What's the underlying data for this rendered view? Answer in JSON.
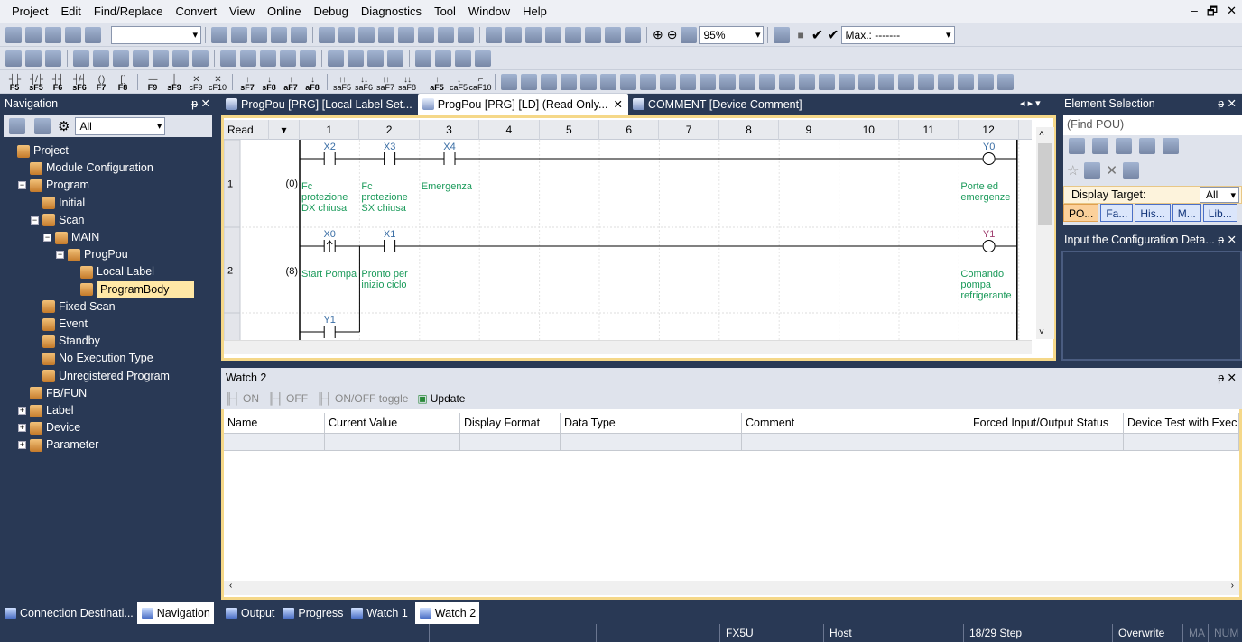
{
  "menu": [
    "Project",
    "Edit",
    "Find/Replace",
    "Convert",
    "View",
    "Online",
    "Debug",
    "Diagnostics",
    "Tool",
    "Window",
    "Help"
  ],
  "window_controls": [
    "–",
    "🗗",
    "✕"
  ],
  "toolbar": {
    "zoom": "95%",
    "max": "Max.: -------",
    "fkeys": [
      "F5",
      "sF5",
      "F6",
      "sF6",
      "F7",
      "F8",
      "F9",
      "sF9",
      "cF9",
      "cF10",
      "sF7",
      "sF8",
      "aF7",
      "aF8",
      "saF5",
      "saF6",
      "saF7",
      "saF8",
      "aF5",
      "caF5",
      "caF10"
    ]
  },
  "navigation": {
    "title": "Navigation",
    "filter": "All",
    "tree": [
      {
        "label": "Project",
        "level": 0,
        "exp": ""
      },
      {
        "label": "Module Configuration",
        "level": 1,
        "exp": ""
      },
      {
        "label": "Program",
        "level": 1,
        "exp": "−"
      },
      {
        "label": "Initial",
        "level": 2,
        "exp": ""
      },
      {
        "label": "Scan",
        "level": 2,
        "exp": "−"
      },
      {
        "label": "MAIN",
        "level": 3,
        "exp": "−"
      },
      {
        "label": "ProgPou",
        "level": 4,
        "exp": "−"
      },
      {
        "label": "Local Label",
        "level": 5,
        "exp": ""
      },
      {
        "label": "ProgramBody",
        "level": 5,
        "exp": "",
        "selected": true
      },
      {
        "label": "Fixed Scan",
        "level": 2,
        "exp": ""
      },
      {
        "label": "Event",
        "level": 2,
        "exp": ""
      },
      {
        "label": "Standby",
        "level": 2,
        "exp": ""
      },
      {
        "label": "No Execution Type",
        "level": 2,
        "exp": ""
      },
      {
        "label": "Unregistered Program",
        "level": 2,
        "exp": ""
      },
      {
        "label": "FB/FUN",
        "level": 1,
        "exp": ""
      },
      {
        "label": "Label",
        "level": 1,
        "exp": "+"
      },
      {
        "label": "Device",
        "level": 1,
        "exp": "+"
      },
      {
        "label": "Parameter",
        "level": 1,
        "exp": "+"
      }
    ]
  },
  "tabs": [
    {
      "label": "ProgPou [PRG] [Local Label Set..."
    },
    {
      "label": "ProgPou [PRG] [LD] (Read Only...",
      "active": true,
      "close": "✕"
    },
    {
      "label": "COMMENT [Device Comment]"
    }
  ],
  "ladder": {
    "mode": "Read",
    "columns": [
      "1",
      "2",
      "3",
      "4",
      "5",
      "6",
      "7",
      "8",
      "9",
      "10",
      "11",
      "12"
    ],
    "rungs": [
      {
        "row": "1",
        "step": "(0)",
        "contacts": [
          {
            "col": 1,
            "device": "X2",
            "type": "no",
            "comment": [
              "Fc",
              "protezione",
              "DX chiusa"
            ]
          },
          {
            "col": 2,
            "device": "X3",
            "type": "no",
            "comment": [
              "Fc",
              "protezione",
              "SX chiusa"
            ]
          },
          {
            "col": 3,
            "device": "X4",
            "type": "no",
            "comment": [
              "Emergenza"
            ]
          }
        ],
        "coil": {
          "device": "Y0",
          "comment": [
            "Porte ed",
            "emergenze"
          ]
        }
      },
      {
        "row": "2",
        "step": "(8)",
        "contacts": [
          {
            "col": 1,
            "device": "X0",
            "type": "rising",
            "comment": [
              "Start Pompa"
            ]
          },
          {
            "col": 2,
            "device": "X1",
            "type": "no",
            "comment": [
              "Pronto per",
              "inizio ciclo"
            ]
          }
        ],
        "coil": {
          "device": "Y1",
          "comment": [
            "Comando",
            "pompa",
            "refrigerante"
          ]
        },
        "branch": {
          "col": 1,
          "device": "Y1"
        }
      }
    ],
    "colors": {
      "comment": "#1a9a5a",
      "device": "#3a6ea5",
      "line": "#000000"
    }
  },
  "element_selection": {
    "title": "Element Selection",
    "find": "(Find POU)",
    "display_target_label": "Display Target:",
    "display_target": "All",
    "tabs": [
      "PO...",
      "Fa...",
      "His...",
      "M...",
      "Lib..."
    ]
  },
  "config_panel": {
    "title": "Input the Configuration Deta..."
  },
  "watch": {
    "title": "Watch 2",
    "buttons": [
      "ON",
      "OFF",
      "ON/OFF toggle",
      "Update"
    ],
    "columns": [
      "Name",
      "Current Value",
      "Display Format",
      "Data Type",
      "Comment",
      "Forced Input/Output Status",
      "Device Test with Exec"
    ]
  },
  "bottom_tabs": [
    {
      "label": "Connection Destinati..."
    },
    {
      "label": "Navigation",
      "active": true
    },
    {
      "label": "Output"
    },
    {
      "label": "Progress"
    },
    {
      "label": "Watch 1"
    },
    {
      "label": "Watch 2",
      "active": true
    }
  ],
  "status": [
    "FX5U",
    "Host",
    "18/29 Step",
    "Overwrite",
    "MA",
    "NUM"
  ]
}
